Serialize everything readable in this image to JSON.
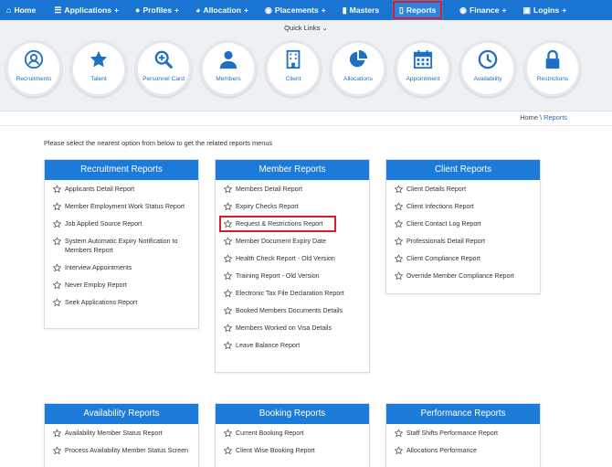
{
  "nav": {
    "items": [
      {
        "label": "Home",
        "icon": "home-icon",
        "caret": ""
      },
      {
        "label": "Applications",
        "icon": "list-icon",
        "caret": "+"
      },
      {
        "label": "Profiles",
        "icon": "user-icon",
        "caret": "+"
      },
      {
        "label": "Allocation",
        "icon": "pie-icon",
        "caret": "+"
      },
      {
        "label": "Placements",
        "icon": "globe-icon",
        "caret": "+"
      },
      {
        "label": "Masters",
        "icon": "folder-icon",
        "caret": ""
      },
      {
        "label": "Reports",
        "icon": "folder-open-icon",
        "caret": ""
      },
      {
        "label": "Finance",
        "icon": "globe-icon",
        "caret": "+"
      },
      {
        "label": "Logins",
        "icon": "lock-icon",
        "caret": "+"
      }
    ],
    "active": "Reports",
    "highlight_color": "#d8202a"
  },
  "quick_links": {
    "title": "Quick Links ⌄",
    "items": [
      {
        "label": "Recruitments",
        "icon": "user-circle-icon"
      },
      {
        "label": "Talent",
        "icon": "star-icon"
      },
      {
        "label": "Personnel Card",
        "icon": "search-plus-icon"
      },
      {
        "label": "Members",
        "icon": "user-icon"
      },
      {
        "label": "Client",
        "icon": "building-icon"
      },
      {
        "label": "Allocations",
        "icon": "pie-chart-icon"
      },
      {
        "label": "Appointment",
        "icon": "calendar-icon"
      },
      {
        "label": "Availability",
        "icon": "clock-icon"
      },
      {
        "label": "Restrictions",
        "icon": "lock-icon"
      }
    ]
  },
  "breadcrumb": {
    "home": "Home",
    "sep": " \\ ",
    "current": "Reports"
  },
  "intro": "Please select the nearest option from below to get the related reports menus",
  "cards": {
    "recruitment": {
      "title": "Recruitment Reports",
      "items": [
        "Applicants Detail Report",
        "Member Employment Work Status Report",
        "Job Applied Source Report",
        "System Automatic Expiry Notification to Members Report",
        "Interview Appointments",
        "Never Employ Report",
        "Seek Applications Report"
      ]
    },
    "member": {
      "title": "Member Reports",
      "items": [
        "Members Detail Report",
        "Expiry Checks Report",
        "Request & Restrictions Report",
        "Member Document Expiry Date",
        "Health Check Report - Old Version",
        "Training Report - Old Version",
        "Electronic Tax File Declaration Report",
        "Booked Members Documents Details",
        "Members Worked on Visa Details",
        "Leave Balance Report"
      ],
      "highlighted": "Request & Restrictions Report"
    },
    "client": {
      "title": "Client Reports",
      "items": [
        "Client Details Report",
        "Client Infections Report",
        "Client Contact Log Report",
        "Professionals Detail Report",
        "Client Compliance Report",
        "Override Member Compliance Report"
      ]
    },
    "availability": {
      "title": "Availability Reports",
      "items": [
        "Availability Member Status Report",
        "Process Availability Member Status Screen"
      ]
    },
    "booking": {
      "title": "Booking Reports",
      "items": [
        "Current Booking Report",
        "Client Wise Booking Report"
      ]
    },
    "performance": {
      "title": "Performance Reports",
      "items": [
        "Staff Shifts Performance Report",
        "Allocations Performance"
      ]
    }
  },
  "colors": {
    "nav_bg": "#1a74d1",
    "card_header": "#1c7ad8",
    "link": "#1f6fc5"
  }
}
